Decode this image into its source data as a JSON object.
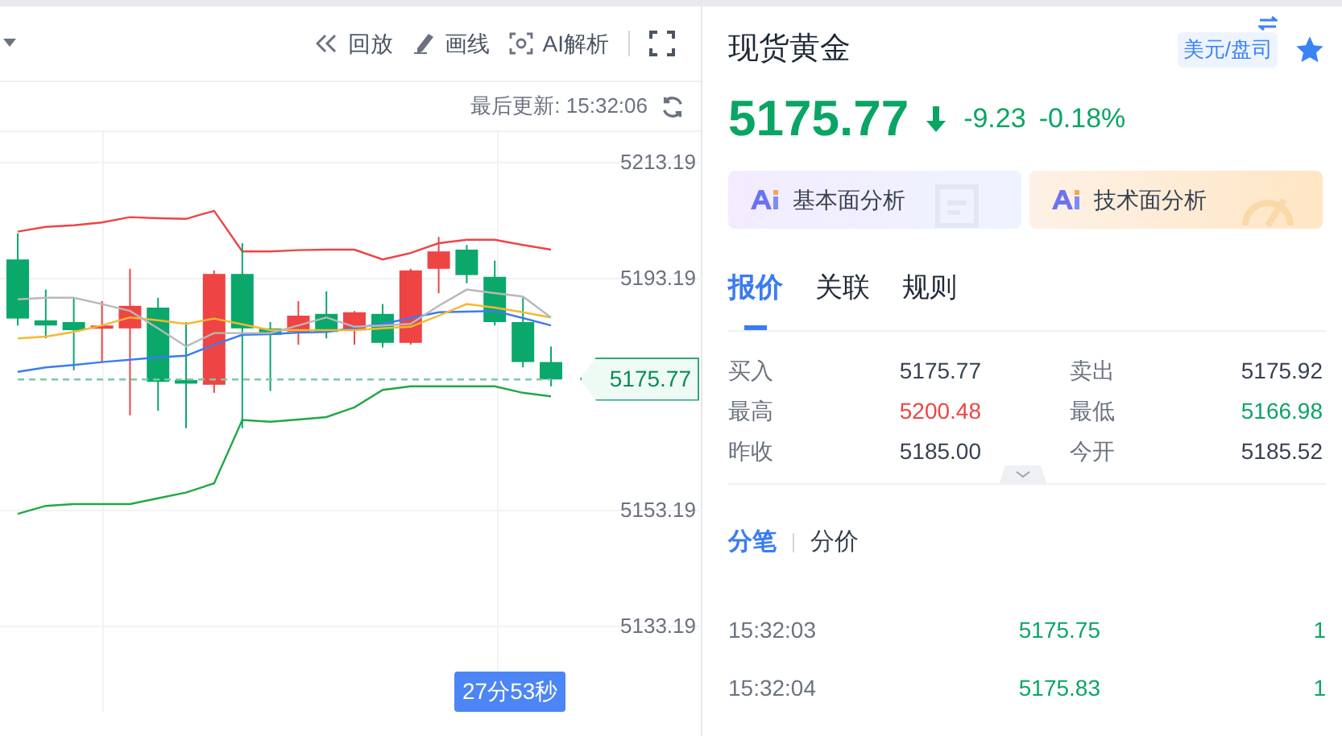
{
  "toolbar": {
    "tools": [
      {
        "label": "回放",
        "kind": "replay"
      },
      {
        "label": "画线",
        "kind": "draw"
      },
      {
        "label": "AI解析",
        "kind": "ai"
      }
    ]
  },
  "last_update": "最后更新: 15:32:06",
  "chart": {
    "price_tag": "5175.77",
    "countdown": "27分53秒",
    "chart_data": {
      "type": "candlestick",
      "grid": true,
      "ylim": [
        5118.47,
        5218.47
      ],
      "yticks": [
        5213.19,
        5193.19,
        5153.19,
        5133.19
      ],
      "ohlc": [
        [
          5196.5,
          5201.0,
          5185.1,
          5186.3
        ],
        [
          5186.0,
          5191.3,
          5182.9,
          5185.1
        ],
        [
          5185.7,
          5189.9,
          5177.4,
          5184.3
        ],
        [
          5184.6,
          5189.3,
          5178.8,
          5185.1
        ],
        [
          5184.6,
          5194.9,
          5169.6,
          5188.5
        ],
        [
          5188.2,
          5189.9,
          5170.4,
          5175.4
        ],
        [
          5175.7,
          5185.7,
          5167.4,
          5175.1
        ],
        [
          5174.9,
          5194.6,
          5173.5,
          5194.0
        ],
        [
          5194.0,
          5199.3,
          5167.4,
          5184.6
        ],
        [
          5184.6,
          5185.7,
          5173.8,
          5183.5
        ],
        [
          5184.0,
          5189.3,
          5181.8,
          5186.8
        ],
        [
          5187.1,
          5191.0,
          5182.9,
          5184.0
        ],
        [
          5184.3,
          5187.6,
          5181.8,
          5187.4
        ],
        [
          5187.1,
          5188.8,
          5181.3,
          5182.1
        ],
        [
          5182.1,
          5194.9,
          5181.8,
          5194.6
        ],
        [
          5194.9,
          5200.4,
          5190.7,
          5197.9
        ],
        [
          5198.2,
          5199.0,
          5192.4,
          5193.8
        ],
        [
          5193.5,
          5196.3,
          5185.1,
          5185.7
        ],
        [
          5185.7,
          5189.9,
          5177.9,
          5178.8
        ],
        [
          5178.8,
          5181.5,
          5174.6,
          5175.8
        ]
      ],
      "series": [
        {
          "type": "line",
          "color": "#ef4444",
          "values": [
            5201.3,
            5202.1,
            5202.4,
            5202.9,
            5203.8,
            5203.6,
            5203.5,
            5204.9,
            5197.9,
            5197.9,
            5198.1,
            5198.2,
            5198.2,
            5196.5,
            5197.6,
            5199.3,
            5199.9,
            5199.9,
            5199.0,
            5198.2
          ]
        },
        {
          "type": "line",
          "color": "#22a845",
          "values": [
            5152.6,
            5154.0,
            5154.3,
            5154.3,
            5154.3,
            5155.3,
            5156.3,
            5157.9,
            5168.8,
            5168.5,
            5168.9,
            5169.3,
            5171.0,
            5174.0,
            5174.6,
            5174.6,
            5174.6,
            5174.6,
            5173.5,
            5172.9
          ]
        },
        {
          "type": "line",
          "color": "#3b7cf0",
          "values": [
            5177.1,
            5177.9,
            5178.3,
            5178.8,
            5179.2,
            5179.6,
            5179.9,
            5181.8,
            5183.5,
            5183.6,
            5183.9,
            5184.0,
            5184.7,
            5185.4,
            5186.4,
            5187.4,
            5187.5,
            5187.6,
            5186.4,
            5185.1
          ]
        },
        {
          "type": "line",
          "color": "#f5b82e",
          "values": [
            5182.9,
            5183.2,
            5184.0,
            5185.1,
            5186.5,
            5186.0,
            5185.4,
            5186.3,
            5185.3,
            5184.3,
            5184.3,
            5184.3,
            5184.3,
            5184.6,
            5184.9,
            5186.8,
            5188.8,
            5188.2,
            5187.4,
            5186.5
          ]
        },
        {
          "type": "line",
          "line_style": "dashed",
          "color": "#7cc9a4",
          "values": [
            5175.8,
            5175.8,
            5175.8,
            5175.8,
            5175.8,
            5175.8,
            5175.8,
            5175.8,
            5175.8,
            5175.8,
            5175.8,
            5175.8,
            5175.8,
            5175.8,
            5175.8,
            5175.8,
            5175.8,
            5175.8,
            5175.8,
            5175.8
          ]
        },
        {
          "type": "line",
          "color": "#b8b8b8",
          "values": [
            5189.6,
            5189.9,
            5189.9,
            5188.8,
            5187.6,
            5184.6,
            5181.5,
            5183.8,
            5183.8,
            5183.8,
            5185.1,
            5186.5,
            5184.9,
            5185.1,
            5185.4,
            5188.5,
            5191.3,
            5190.7,
            5190.1,
            5186.5
          ]
        }
      ]
    }
  },
  "quote": {
    "title": "现货黄金",
    "unit": "美元/盘司",
    "favorite": true,
    "price": "5175.77",
    "falling": true,
    "change": "-9.23",
    "change_pct": "-0.18%"
  },
  "analysis_buttons": [
    {
      "label": "基本面分析",
      "kind": "fundamental"
    },
    {
      "label": "技术面分析",
      "kind": "technical"
    }
  ],
  "tabs": [
    {
      "label": "报价",
      "selected": true
    },
    {
      "label": "关联",
      "selected": false
    },
    {
      "label": "规则",
      "selected": false
    }
  ],
  "stats": [
    {
      "label": "买入",
      "value": "5175.77",
      "color": "#374151"
    },
    {
      "label": "卖出",
      "value": "5175.92",
      "color": "#374151"
    },
    {
      "label": "最高",
      "value": "5200.48",
      "color": "#ef4444"
    },
    {
      "label": "最低",
      "value": "5166.98",
      "color": "#0aa564"
    },
    {
      "label": "昨收",
      "value": "5185.00",
      "color": "#374151"
    },
    {
      "label": "今开",
      "value": "5185.52",
      "color": "#374151"
    }
  ],
  "trade_tabs": [
    {
      "label": "分笔",
      "selected": true
    },
    {
      "label": "分价",
      "selected": false
    }
  ],
  "trades": [
    {
      "time": "15:32:03",
      "price": "5175.75",
      "volume": "1"
    },
    {
      "time": "15:32:04",
      "price": "5175.83",
      "volume": "1"
    }
  ]
}
